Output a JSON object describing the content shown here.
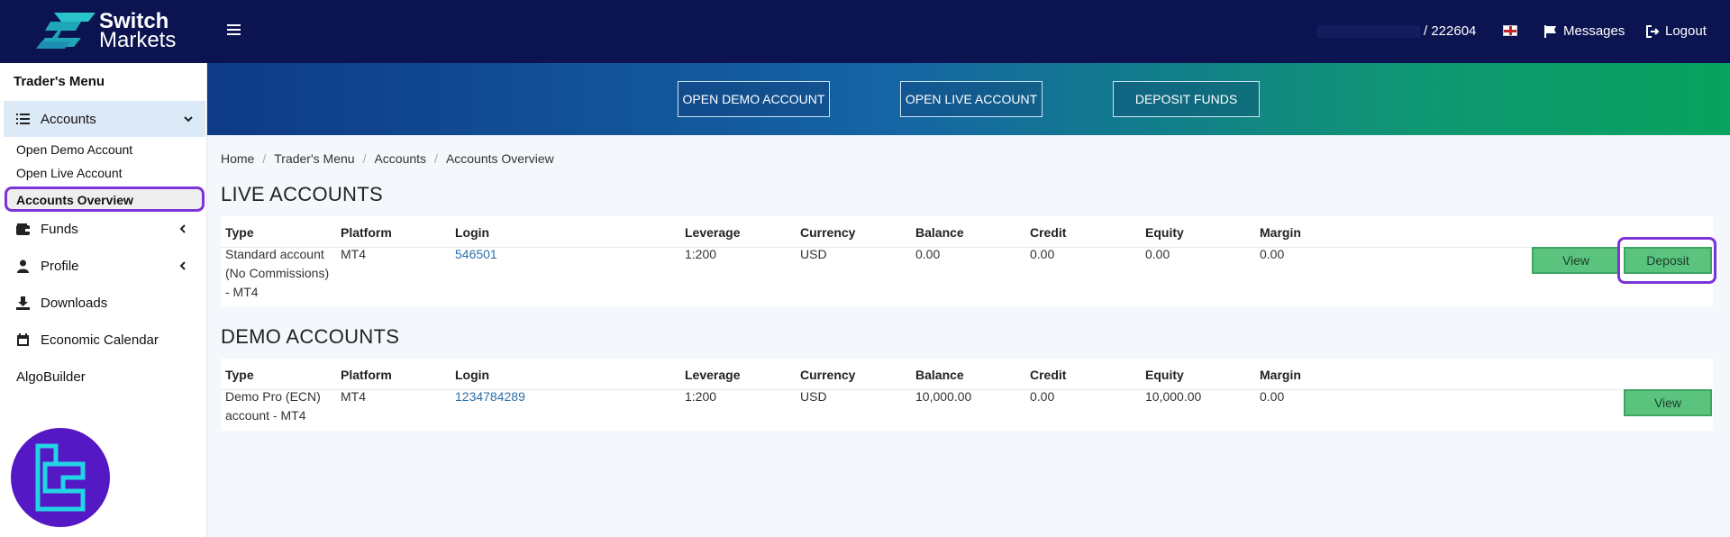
{
  "brand": {
    "name_line1": "Switch",
    "name_line2": "Markets"
  },
  "header": {
    "account_suffix": "/ 222604",
    "messages_label": "Messages",
    "logout_label": "Logout"
  },
  "sidebar": {
    "title": "Trader's Menu",
    "accounts_label": "Accounts",
    "sub_items": [
      "Open Demo Account",
      "Open Live Account",
      "Accounts Overview"
    ],
    "items": [
      "Funds",
      "Profile",
      "Downloads",
      "Economic Calendar",
      "AlgoBuilder"
    ]
  },
  "banner": {
    "buttons": [
      "OPEN DEMO ACCOUNT",
      "OPEN LIVE ACCOUNT",
      "DEPOSIT FUNDS"
    ]
  },
  "breadcrumb": [
    "Home",
    "Trader's Menu",
    "Accounts",
    "Accounts Overview"
  ],
  "columns": [
    "Type",
    "Platform",
    "Login",
    "Leverage",
    "Currency",
    "Balance",
    "Credit",
    "Equity",
    "Margin"
  ],
  "live": {
    "title": "LIVE ACCOUNTS",
    "row": {
      "type_lines": [
        "Standard account",
        "(No Commissions)",
        "- MT4"
      ],
      "platform": "MT4",
      "login": "546501",
      "leverage": "1:200",
      "currency": "USD",
      "balance": "0.00",
      "credit": "0.00",
      "equity": "0.00",
      "margin": "0.00",
      "view_label": "View",
      "deposit_label": "Deposit"
    }
  },
  "demo": {
    "title": "DEMO ACCOUNTS",
    "row": {
      "type_lines": [
        "Demo Pro (ECN)",
        "account - MT4"
      ],
      "platform": "MT4",
      "login": "1234784289",
      "leverage": "1:200",
      "currency": "USD",
      "balance": "10,000.00",
      "credit": "0.00",
      "equity": "10,000.00",
      "margin": "0.00",
      "view_label": "View"
    }
  },
  "colors": {
    "header_bg": "#0b1450",
    "accent_purple": "#7b34d6",
    "button_green": "#5ac47f",
    "link_blue": "#2d6fa8"
  }
}
